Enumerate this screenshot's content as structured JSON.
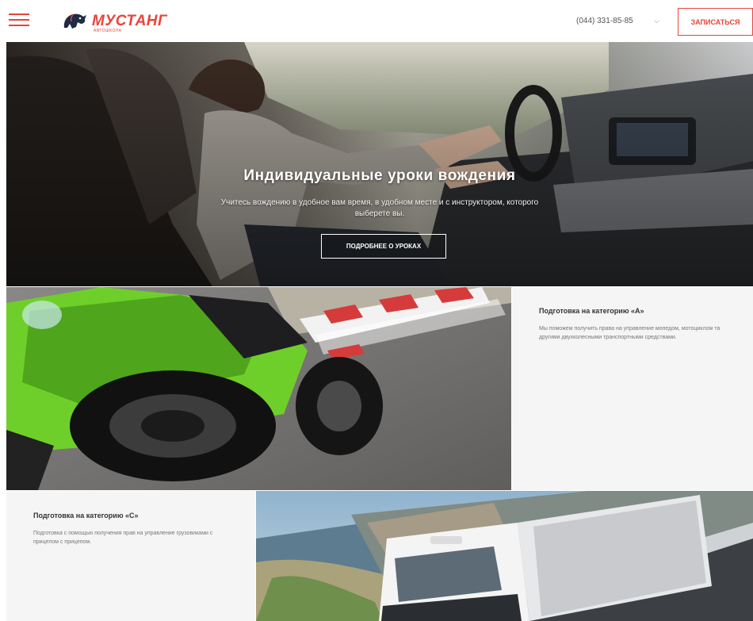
{
  "header": {
    "logo_text": "МУСТАНГ",
    "logo_subtext": "АВТОШКОЛА",
    "phone": "(044) 331-85-85",
    "phone_caret": "⌵",
    "signup_label": "Записаться"
  },
  "hero": {
    "title": "Индивидуальные уроки вождения",
    "text": "Учитесь вождению в удобное вам время, в удобном месте и с инструктором, которого выберете вы.",
    "button_label": "Подробнее о уроках"
  },
  "category_a": {
    "title": "Подготовка на категорию «А»",
    "text": "Мы поможем получить права на управление мопедом, мотоциклом та другими двухколесными транспортными средствами."
  },
  "category_c": {
    "title": "Подготовка на категорию «С»",
    "text": "Подготовка с помощью получения прав на управление грузовиками с прицепом с прицепом."
  },
  "colors": {
    "brand": "#e8443a",
    "panel_bg": "#f5f5f5",
    "moto_green": "#6fcf2a"
  },
  "icons": {
    "menu": "hamburger-menu-icon",
    "logo": "mustang-horse-logo-icon"
  }
}
